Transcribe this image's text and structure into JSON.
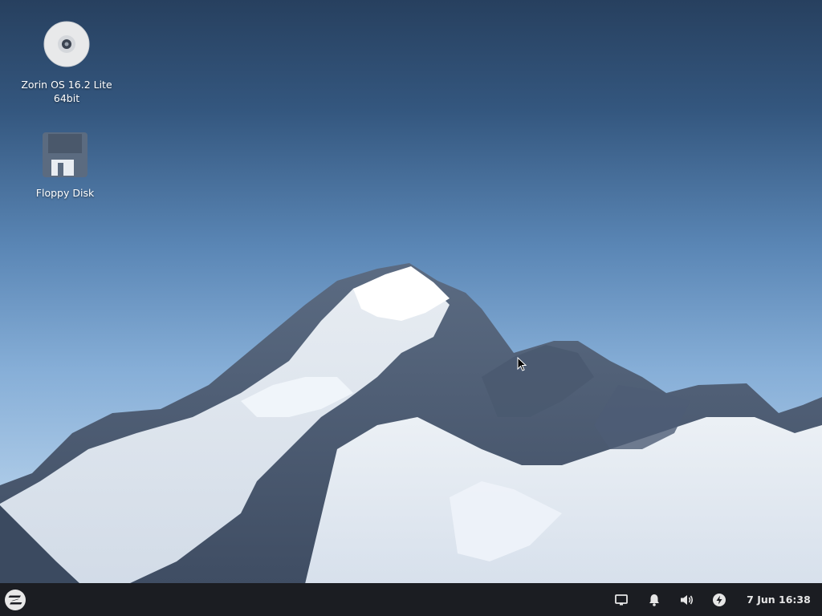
{
  "desktop": {
    "icons": [
      {
        "label": "Zorin OS 16.2 Lite\n64bit",
        "icon": "cd-disc-icon"
      },
      {
        "label": "Floppy Disk",
        "icon": "floppy-disk-icon"
      }
    ],
    "wallpaper": "snowy-mountain-peak"
  },
  "taskbar": {
    "menu_icon": "zorin-logo-icon",
    "tray_icons": [
      "display-icon",
      "notification-bell-icon",
      "volume-icon",
      "power-icon"
    ],
    "clock": "7 Jun 16:38"
  },
  "colors": {
    "taskbar_bg": "#1b1d22",
    "sky_top": "#27405f",
    "sky_bottom": "#b8d3ec"
  }
}
